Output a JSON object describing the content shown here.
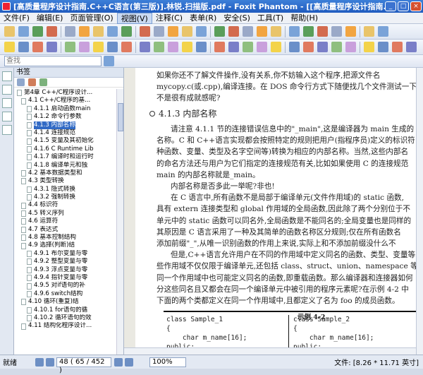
{
  "window": {
    "title": "[高质量程序设计指南.C++C语言(第三版)].林锐.扫描版.pdf - Foxit Phantom - [[高质量程序设计指南.C++C语言(第三版)].林..."
  },
  "menu": [
    "文件(F)",
    "编辑(E)",
    "页面管理(O)",
    "视图(V)",
    "注释(C)",
    "表单(R)",
    "安全(S)",
    "工具(T)",
    "帮助(H)"
  ],
  "search": {
    "placeholder": "查找"
  },
  "bookmarks": {
    "title": "书签",
    "items": [
      "第4章 C++/C程序设计...",
      "4.1 C++/C程序的基...",
      "4.1.1 启动函数main",
      "4.1.2 命令行参数",
      "4.1.3 内部名称",
      "4.1.4 连接规范",
      "4.1.5 变量及其初始化",
      "4.1.6 C Runtime Lib",
      "4.1.7 编译时和运行时",
      "4.1.8 编译单元和独",
      "4.2 基本数据类型和",
      "4.3 类型转换",
      "4.3.1 隐式转换",
      "4.3.2 强制转换",
      "4.4 标识符",
      "4.5 转义序列",
      "4.6 运算符",
      "4.7 表达式",
      "4.8 基本控制结构",
      "4.9 选择(判断)结",
      "4.9.1 布尔变量与零",
      "4.9.2 整型变量与零",
      "4.9.3 浮点变量与零",
      "4.9.4 指针变量与零",
      "4.9.5 对if语句的补",
      "4.9.6 switch结构",
      "4.10 循环(重复)结",
      "4.10.1 for语句的循",
      "4.10.2 循环语句的效",
      "4.11 结构化程序设计..."
    ],
    "selected_index": 4
  },
  "document": {
    "lines_top": [
      "如果你还不了解文件操作,没有关系,你不妨输入这个程序,把源文件名",
      "mycopy.c(或.cpp),编译连接。在 DOS 命令行方式下随便找几个文件测试一下",
      "不是很有成就感呢?"
    ],
    "section": "4.1.3   内部名称",
    "para": [
      "请注意 4.1.1 节的连接错误信息中的\"_main\",这是编译器为 main 生成的",
      "名称。C 和 C++语言实现都会按照特定的规则把用户(指程序员)定义的标识符",
      "种函数、变量、类型及名字空间等)转换为相应的内部名称。当然,这些内部名",
      "的命名方法还与用户为它们指定的连接规范有关,比如如果使用 C 的连接规范",
      "main 的内部名称就是_main。",
      "内部名称是否多此一举呢?非也!",
      "在 C 语言中,所有函数不是局部于编译单元(文件作用域)的 static 函数,",
      "具有 extern 连接类型和 global 作用域的全局函数,因此除了两个分别位于不",
      "单元中的 static 函数可以同名外,全局函数是不能同名的;全局变量也是同样的",
      "其原因是 C 语言采用了一种及其简单的函数名称区分规则;仅在所有函数名",
      "添加前缀\"_\",从唯一识别函数的作用上来说,实际上和不添加前缀没什么不",
      "但是,C++语言允许用户在不同的作用域中定义同名的函数、类型、变量等",
      "些作用域不仅仅限于编译单元,还包括 class、struct、union、namespace 等;",
      "同一个作用域中也可能定义同名的函数,即重载函数。那么编译器和连接器如何",
      "分这些同名且又都会在同一个编译单元中被引用的程序元素呢?在示例 4-2 中",
      "下面的两个类都定义在同一个作用域中,且都定义了名为 foo 的成员函数。"
    ],
    "example_label": "示例 4-2",
    "code_left": [
      "class Sample_1",
      "{",
      "    char m_name[16];",
      "public:"
    ],
    "code_right": [
      "class Sample_2",
      "{",
      "    char m_name[16];",
      "public:"
    ]
  },
  "status": {
    "ready": "就绪",
    "page_box": "48 ( 65 / 452 )",
    "zoom": "100%",
    "doc_size": "文件: [8.26 * 11.71 英寸]"
  }
}
